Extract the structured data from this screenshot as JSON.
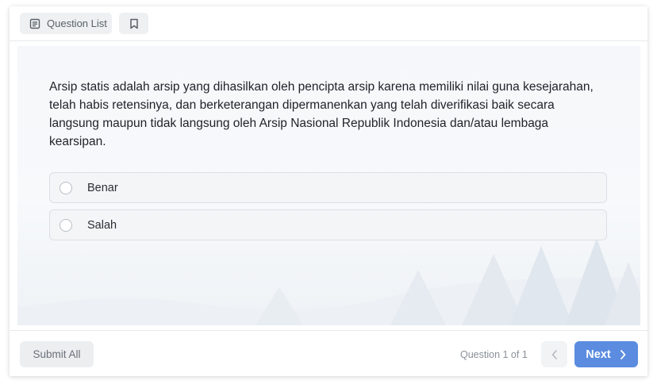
{
  "toolbar": {
    "question_list_label": "Question List",
    "question_list_icon": "list-icon",
    "bookmark_icon": "bookmark-icon"
  },
  "question": {
    "text": "Arsip statis adalah arsip yang dihasilkan oleh pencipta arsip karena memiliki nilai guna kesejarahan, telah habis retensinya, dan berketerangan dipermanenkan yang telah diverifikasi baik secara langsung maupun tidak langsung oleh Arsip Nasional Republik Indonesia dan/atau lembaga kearsipan.",
    "options": [
      {
        "label": "Benar",
        "selected": false
      },
      {
        "label": "Salah",
        "selected": false
      }
    ]
  },
  "footer": {
    "submit_label": "Submit All",
    "counter": "Question 1 of 1",
    "prev_icon": "chevron-left-icon",
    "next_label": "Next",
    "next_icon": "chevron-right-icon"
  },
  "colors": {
    "accent": "#5b8ce0",
    "option_bg": "#f4f5f7",
    "panel_bg": "#f5f7fa"
  }
}
